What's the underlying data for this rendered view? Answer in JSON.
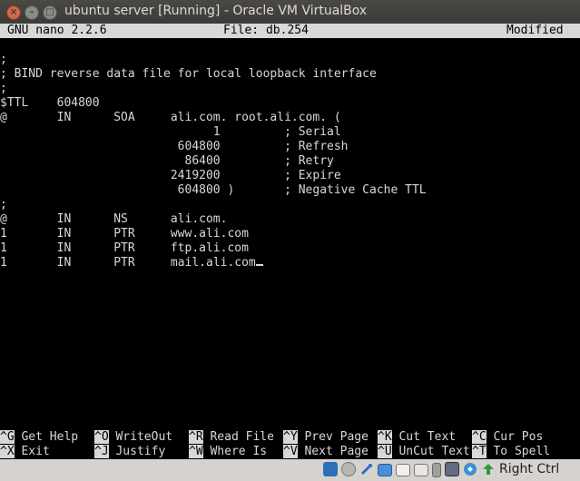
{
  "window": {
    "title": "ubuntu server [Running] - Oracle VM VirtualBox"
  },
  "nano": {
    "version": "GNU nano 2.2.6",
    "file": "File: db.254",
    "status": "Modified"
  },
  "editor_lines": [
    ";",
    "; BIND reverse data file for local loopback interface",
    ";",
    "$TTL    604800",
    "@       IN      SOA     ali.com. root.ali.com. (",
    "                              1         ; Serial",
    "                         604800         ; Refresh",
    "                          86400         ; Retry",
    "                        2419200         ; Expire",
    "                         604800 )       ; Negative Cache TTL",
    ";",
    "@       IN      NS      ali.com.",
    "1       IN      PTR     www.ali.com",
    "1       IN      PTR     ftp.ali.com",
    "1       IN      PTR     mail.ali.com"
  ],
  "shortcuts_row1": [
    {
      "key": "^G",
      "label": " Get Help"
    },
    {
      "key": "^O",
      "label": " WriteOut"
    },
    {
      "key": "^R",
      "label": " Read File"
    },
    {
      "key": "^Y",
      "label": " Prev Page"
    },
    {
      "key": "^K",
      "label": " Cut Text"
    },
    {
      "key": "^C",
      "label": " Cur Pos"
    }
  ],
  "shortcuts_row2": [
    {
      "key": "^X",
      "label": " Exit"
    },
    {
      "key": "^J",
      "label": " Justify"
    },
    {
      "key": "^W",
      "label": " Where Is"
    },
    {
      "key": "^V",
      "label": " Next Page"
    },
    {
      "key": "^U",
      "label": " UnCut Text"
    },
    {
      "key": "^T",
      "label": " To Spell"
    }
  ],
  "statusbar": {
    "host_key": "Right Ctrl",
    "icons": [
      "hard-disk-icon",
      "optical-drive-icon",
      "usb-icon",
      "shared-folders-icon",
      "display-icon",
      "video-capture-icon",
      "network-icon",
      "cpu-icon",
      "mouse-integration-icon",
      "keyboard-capture-icon"
    ]
  }
}
